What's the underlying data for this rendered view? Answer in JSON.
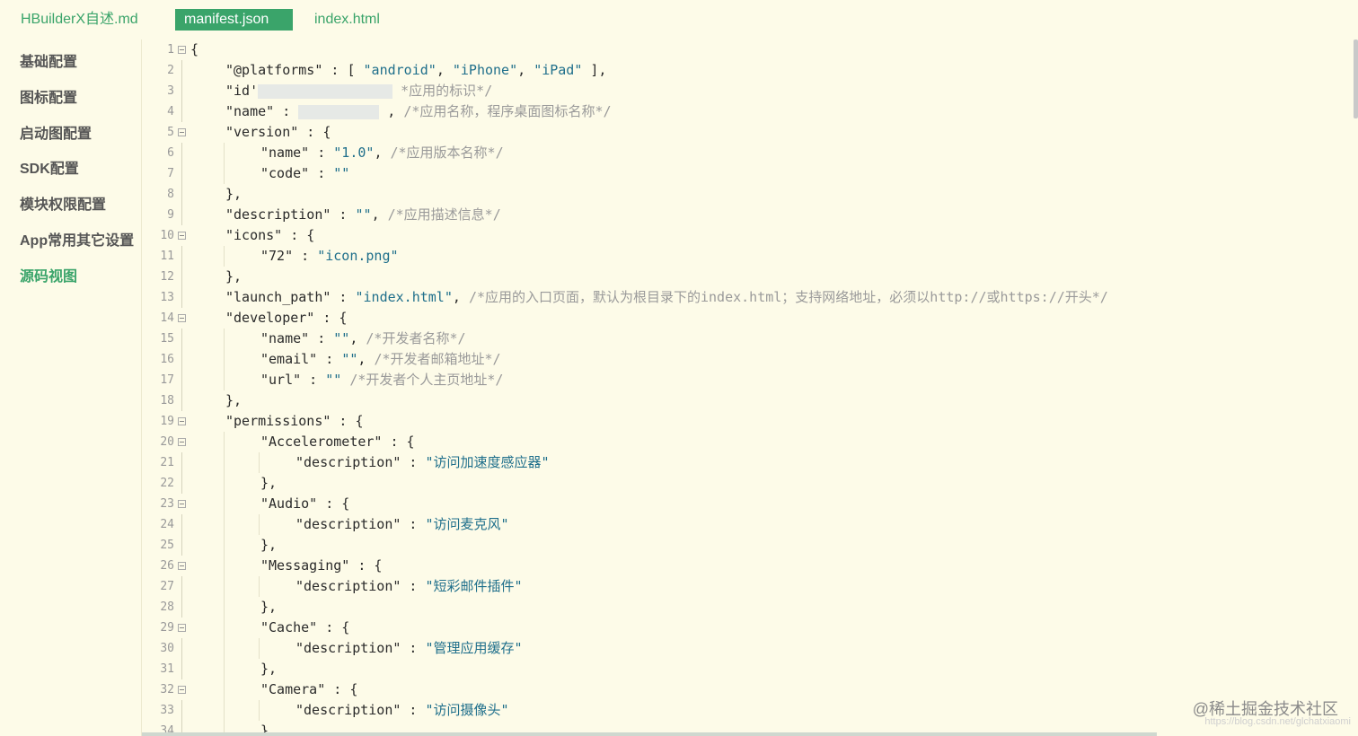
{
  "tabs": [
    {
      "label": "HBuilderX自述.md",
      "active": false
    },
    {
      "label": "manifest.json",
      "active": true
    },
    {
      "label": "index.html",
      "active": false
    }
  ],
  "sidebar": {
    "items": [
      {
        "label": "基础配置",
        "active": false
      },
      {
        "label": "图标配置",
        "active": false
      },
      {
        "label": "启动图配置",
        "active": false
      },
      {
        "label": "SDK配置",
        "active": false
      },
      {
        "label": "模块权限配置",
        "active": false
      },
      {
        "label": "App常用其它设置",
        "active": false
      },
      {
        "label": "源码视图",
        "active": true
      }
    ]
  },
  "editor": {
    "lines": [
      {
        "n": "1",
        "fold": true,
        "indent": 0,
        "parts": [
          {
            "t": "k",
            "v": "{"
          }
        ]
      },
      {
        "n": "2",
        "fold": false,
        "indent": 1,
        "parts": [
          {
            "t": "k",
            "v": "\"@platforms\" : [ "
          },
          {
            "t": "s",
            "v": "\"android\""
          },
          {
            "t": "k",
            "v": ", "
          },
          {
            "t": "s",
            "v": "\"iPhone\""
          },
          {
            "t": "k",
            "v": ", "
          },
          {
            "t": "s",
            "v": "\"iPad\""
          },
          {
            "t": "k",
            "v": " ],"
          }
        ]
      },
      {
        "n": "3",
        "fold": false,
        "indent": 1,
        "parts": [
          {
            "t": "k",
            "v": "\"id'"
          },
          {
            "t": "b",
            "v": "150"
          },
          {
            "t": "c",
            "v": " *应用的标识*/"
          }
        ]
      },
      {
        "n": "4",
        "fold": false,
        "indent": 1,
        "parts": [
          {
            "t": "k",
            "v": "\"name\" : "
          },
          {
            "t": "b",
            "v": "90"
          },
          {
            "t": "k",
            "v": " , "
          },
          {
            "t": "c",
            "v": "/*应用名称，程序桌面图标名称*/"
          }
        ]
      },
      {
        "n": "5",
        "fold": true,
        "indent": 1,
        "parts": [
          {
            "t": "k",
            "v": "\"version\" : {"
          }
        ]
      },
      {
        "n": "6",
        "fold": false,
        "indent": 2,
        "parts": [
          {
            "t": "k",
            "v": "\"name\" : "
          },
          {
            "t": "s",
            "v": "\"1.0\""
          },
          {
            "t": "k",
            "v": ", "
          },
          {
            "t": "c",
            "v": "/*应用版本名称*/"
          }
        ]
      },
      {
        "n": "7",
        "fold": false,
        "indent": 2,
        "parts": [
          {
            "t": "k",
            "v": "\"code\" : "
          },
          {
            "t": "s",
            "v": "\"\""
          }
        ]
      },
      {
        "n": "8",
        "fold": false,
        "indent": 1,
        "parts": [
          {
            "t": "k",
            "v": "},"
          }
        ]
      },
      {
        "n": "9",
        "fold": false,
        "indent": 1,
        "parts": [
          {
            "t": "k",
            "v": "\"description\" : "
          },
          {
            "t": "s",
            "v": "\"\""
          },
          {
            "t": "k",
            "v": ", "
          },
          {
            "t": "c",
            "v": "/*应用描述信息*/"
          }
        ]
      },
      {
        "n": "10",
        "fold": true,
        "indent": 1,
        "parts": [
          {
            "t": "k",
            "v": "\"icons\" : {"
          }
        ]
      },
      {
        "n": "11",
        "fold": false,
        "indent": 2,
        "parts": [
          {
            "t": "k",
            "v": "\"72\" : "
          },
          {
            "t": "s",
            "v": "\"icon.png\""
          }
        ]
      },
      {
        "n": "12",
        "fold": false,
        "indent": 1,
        "parts": [
          {
            "t": "k",
            "v": "},"
          }
        ]
      },
      {
        "n": "13",
        "fold": false,
        "indent": 1,
        "parts": [
          {
            "t": "k",
            "v": "\"launch_path\" : "
          },
          {
            "t": "s",
            "v": "\"index.html\""
          },
          {
            "t": "k",
            "v": ", "
          },
          {
            "t": "c",
            "v": "/*应用的入口页面，默认为根目录下的index.html；支持网络地址，必须以http://或https://开头*/"
          }
        ]
      },
      {
        "n": "14",
        "fold": true,
        "indent": 1,
        "parts": [
          {
            "t": "k",
            "v": "\"developer\" : {"
          }
        ]
      },
      {
        "n": "15",
        "fold": false,
        "indent": 2,
        "parts": [
          {
            "t": "k",
            "v": "\"name\" : "
          },
          {
            "t": "s",
            "v": "\"\""
          },
          {
            "t": "k",
            "v": ", "
          },
          {
            "t": "c",
            "v": "/*开发者名称*/"
          }
        ]
      },
      {
        "n": "16",
        "fold": false,
        "indent": 2,
        "parts": [
          {
            "t": "k",
            "v": "\"email\" : "
          },
          {
            "t": "s",
            "v": "\"\""
          },
          {
            "t": "k",
            "v": ", "
          },
          {
            "t": "c",
            "v": "/*开发者邮箱地址*/"
          }
        ]
      },
      {
        "n": "17",
        "fold": false,
        "indent": 2,
        "parts": [
          {
            "t": "k",
            "v": "\"url\" : "
          },
          {
            "t": "s",
            "v": "\"\""
          },
          {
            "t": "k",
            "v": " "
          },
          {
            "t": "c",
            "v": "/*开发者个人主页地址*/"
          }
        ]
      },
      {
        "n": "18",
        "fold": false,
        "indent": 1,
        "parts": [
          {
            "t": "k",
            "v": "},"
          }
        ]
      },
      {
        "n": "19",
        "fold": true,
        "indent": 1,
        "parts": [
          {
            "t": "k",
            "v": "\"permissions\" : {"
          }
        ]
      },
      {
        "n": "20",
        "fold": true,
        "indent": 2,
        "parts": [
          {
            "t": "k",
            "v": "\"Accelerometer\" : {"
          }
        ]
      },
      {
        "n": "21",
        "fold": false,
        "indent": 3,
        "parts": [
          {
            "t": "k",
            "v": "\"description\" : "
          },
          {
            "t": "s",
            "v": "\"访问加速度感应器\""
          }
        ]
      },
      {
        "n": "22",
        "fold": false,
        "indent": 2,
        "parts": [
          {
            "t": "k",
            "v": "},"
          }
        ]
      },
      {
        "n": "23",
        "fold": true,
        "indent": 2,
        "parts": [
          {
            "t": "k",
            "v": "\"Audio\" : {"
          }
        ]
      },
      {
        "n": "24",
        "fold": false,
        "indent": 3,
        "parts": [
          {
            "t": "k",
            "v": "\"description\" : "
          },
          {
            "t": "s",
            "v": "\"访问麦克风\""
          }
        ]
      },
      {
        "n": "25",
        "fold": false,
        "indent": 2,
        "parts": [
          {
            "t": "k",
            "v": "},"
          }
        ]
      },
      {
        "n": "26",
        "fold": true,
        "indent": 2,
        "parts": [
          {
            "t": "k",
            "v": "\"Messaging\" : {"
          }
        ]
      },
      {
        "n": "27",
        "fold": false,
        "indent": 3,
        "parts": [
          {
            "t": "k",
            "v": "\"description\" : "
          },
          {
            "t": "s",
            "v": "\"短彩邮件插件\""
          }
        ]
      },
      {
        "n": "28",
        "fold": false,
        "indent": 2,
        "parts": [
          {
            "t": "k",
            "v": "},"
          }
        ]
      },
      {
        "n": "29",
        "fold": true,
        "indent": 2,
        "parts": [
          {
            "t": "k",
            "v": "\"Cache\" : {"
          }
        ]
      },
      {
        "n": "30",
        "fold": false,
        "indent": 3,
        "parts": [
          {
            "t": "k",
            "v": "\"description\" : "
          },
          {
            "t": "s",
            "v": "\"管理应用缓存\""
          }
        ]
      },
      {
        "n": "31",
        "fold": false,
        "indent": 2,
        "parts": [
          {
            "t": "k",
            "v": "},"
          }
        ]
      },
      {
        "n": "32",
        "fold": true,
        "indent": 2,
        "parts": [
          {
            "t": "k",
            "v": "\"Camera\" : {"
          }
        ]
      },
      {
        "n": "33",
        "fold": false,
        "indent": 3,
        "parts": [
          {
            "t": "k",
            "v": "\"description\" : "
          },
          {
            "t": "s",
            "v": "\"访问摄像头\""
          }
        ]
      },
      {
        "n": "34",
        "fold": false,
        "indent": 2,
        "parts": [
          {
            "t": "k",
            "v": "},"
          }
        ]
      }
    ]
  },
  "watermark": {
    "main": "@稀土掘金技术社区",
    "sub": "https://blog.csdn.net/glchatxiaomi"
  },
  "colors": {
    "accent": "#3aa46a",
    "background": "#fdfbe8",
    "string": "#1f6f8b",
    "comment": "#9a9a9a"
  }
}
